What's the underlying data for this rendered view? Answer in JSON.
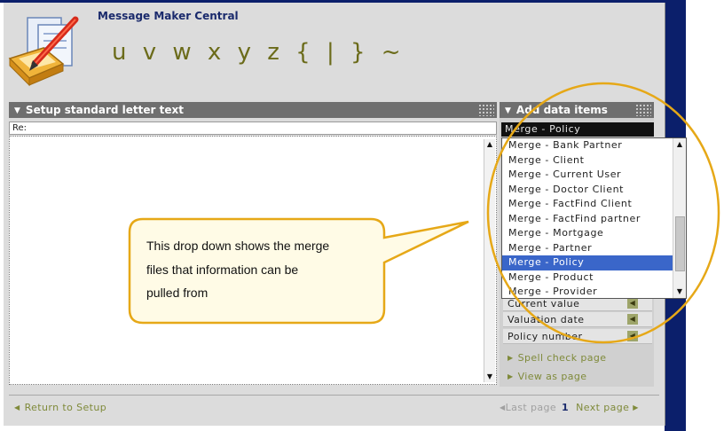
{
  "app": {
    "title": "Message Maker Central",
    "glyph_line": "u v w x y z { | } ~"
  },
  "left_panel": {
    "title": "Setup standard letter text",
    "re_label": "Re:"
  },
  "right_panel": {
    "title": "Add data items",
    "selected_value": "Merge - Policy",
    "dropdown_options": [
      "Merge - Bank Partner",
      "Merge - Client",
      "Merge - Current User",
      "Merge - Doctor Client",
      "Merge - FactFind Client",
      "Merge - FactFind partner",
      "Merge - Mortgage",
      "Merge - Partner",
      "Merge - Policy",
      "Merge - Product",
      "Merge - Provider"
    ],
    "selected_index": 8,
    "fields": [
      "Current value",
      "Valuation date",
      "Policy number"
    ],
    "links": {
      "spell_check": "Spell check page",
      "view": "View as page"
    }
  },
  "footer": {
    "return_link": "Return to Setup",
    "last_page": "Last page",
    "page_number": "1",
    "next_page": "Next page"
  },
  "callout": {
    "lines": [
      "This drop down shows the merge",
      "files that information can be",
      "pulled from"
    ]
  },
  "colors": {
    "accent_olive": "#7f8a3a",
    "highlight": "#3a66c9",
    "callout_stroke": "#e6a817",
    "frame": "#0b1f6b"
  }
}
